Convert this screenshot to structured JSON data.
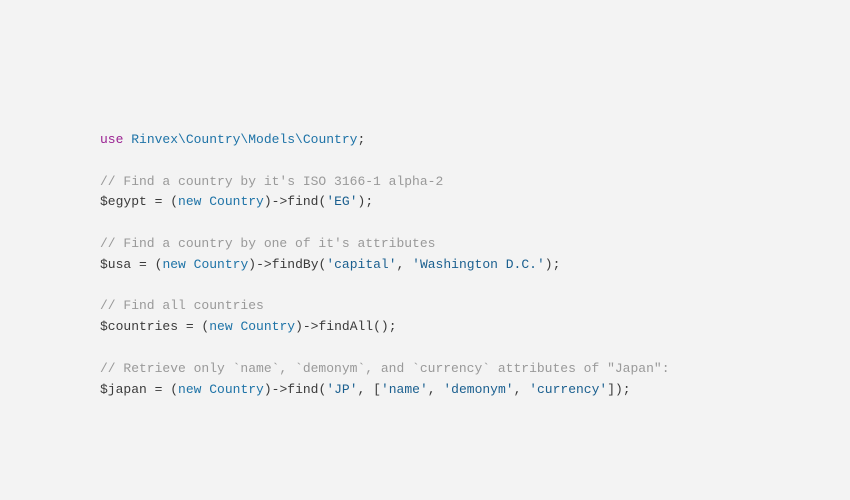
{
  "code": {
    "line1": {
      "use": "use",
      "namespace": "Rinvex\\Country\\Models\\Country",
      "semi": ";"
    },
    "line2": {
      "comment": "// Find a country by it's ISO 3166-1 alpha-2"
    },
    "line3": {
      "var": "$egypt",
      "eq": " = (",
      "new": "new",
      "sp": " ",
      "class": "Country",
      "close_paren": ")",
      "arrow": "->",
      "method": "find",
      "open": "(",
      "arg1": "'EG'",
      "end": ");"
    },
    "line4": {
      "comment": "// Find a country by one of it's attributes"
    },
    "line5": {
      "var": "$usa",
      "eq": " = (",
      "new": "new",
      "sp": " ",
      "class": "Country",
      "close_paren": ")",
      "arrow": "->",
      "method": "findBy",
      "open": "(",
      "arg1": "'capital'",
      "comma": ", ",
      "arg2": "'Washington D.C.'",
      "end": ");"
    },
    "line6": {
      "comment": "// Find all countries"
    },
    "line7": {
      "var": "$countries",
      "eq": " = (",
      "new": "new",
      "sp": " ",
      "class": "Country",
      "close_paren": ")",
      "arrow": "->",
      "method": "findAll",
      "open": "(",
      "end": ");"
    },
    "line8": {
      "comment": "// Retrieve only `name`, `demonym`, and `currency` attributes of \"Japan\":"
    },
    "line9": {
      "var": "$japan",
      "eq": " = (",
      "new": "new",
      "sp": " ",
      "class": "Country",
      "close_paren": ")",
      "arrow": "->",
      "method": "find",
      "open": "(",
      "arg1": "'JP'",
      "comma": ", [",
      "arg2": "'name'",
      "comma2": ", ",
      "arg3": "'demonym'",
      "comma3": ", ",
      "arg4": "'currency'",
      "end": "]);"
    }
  }
}
